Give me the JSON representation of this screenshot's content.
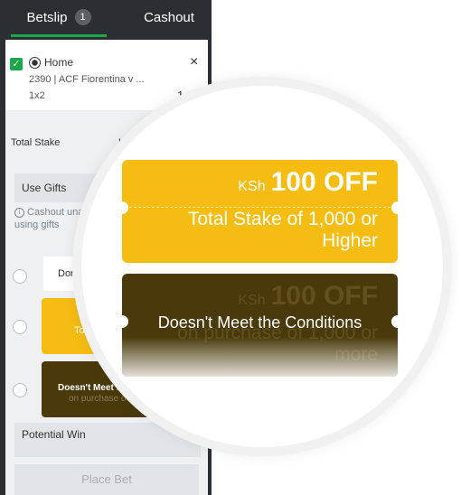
{
  "tabs": {
    "betslip_label": "Betslip",
    "betslip_count": "1",
    "cashout_label": "Cashout"
  },
  "bet": {
    "selection": "Home",
    "match": "2390 | ACF Fiorentina v ...",
    "market": "1x2",
    "odds": "1.28",
    "close_symbol": "×",
    "check_symbol": "✓"
  },
  "stake": {
    "label": "Total Stake",
    "currency": "KSh"
  },
  "gifts": {
    "label": "Use Gifts",
    "info_line1": "Cashout una",
    "info_line2": "using gifts",
    "info_icon": "i"
  },
  "mini_coupons": {
    "white_text": "Dor",
    "yellow_text": "To",
    "dark_text": "Doesn't Meet t",
    "dark_sub": "on purchase o"
  },
  "potential": {
    "label": "Potential Win"
  },
  "place_bet": {
    "label": "Place Bet"
  },
  "colors": {
    "panel_bg": "#2b2e33",
    "tab_underline": "#1aa84b",
    "coupon_yellow": "#f5bc11",
    "coupon_dark": "#4a3a0b"
  },
  "magnified": {
    "eligible": {
      "currency": "KSh",
      "amount": "100 OFF",
      "condition": "Total Stake of 1,000 or Higher"
    },
    "ineligible": {
      "currency": "KSh",
      "amount": "100 OFF",
      "condition": "on purchase of 1,000 or more",
      "overlay": "Doesn't Meet the Conditions"
    }
  }
}
